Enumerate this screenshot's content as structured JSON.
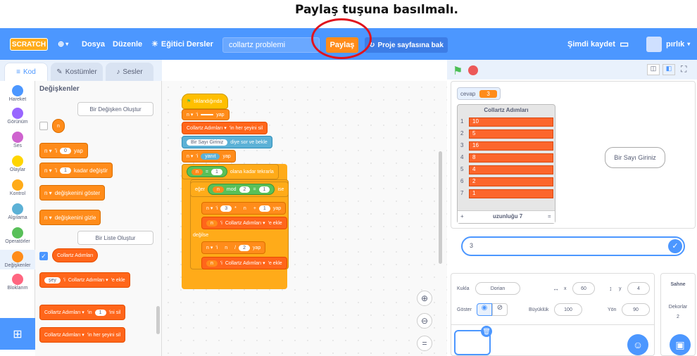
{
  "caption": "Paylaş tuşuna basılmalı.",
  "menubar": {
    "logo": "SCRATCH",
    "file": "Dosya",
    "edit": "Düzenle",
    "tutorials": "Eğitici Dersler",
    "project_title": "collartz problemi",
    "share": "Paylaş",
    "project_page": "Proje sayfasına bak",
    "save_now": "Şimdi kaydet",
    "username": "pırlık"
  },
  "tabs": {
    "code": "Kod",
    "costumes": "Kostümler",
    "sounds": "Sesler"
  },
  "categories": [
    "Hareket",
    "Görünüm",
    "Ses",
    "Olaylar",
    "Kontrol",
    "Algılama",
    "Operatörler",
    "Değişkenler",
    "Bloklarım"
  ],
  "palette": {
    "title": "Değişkenler",
    "make_var": "Bir Değişken Oluştur",
    "var_n": "n",
    "set_block": [
      "n ▾",
      "'i",
      "0",
      "yap"
    ],
    "change_block": [
      "n ▾",
      "'i",
      "1",
      "kadar değiştir"
    ],
    "show_var": [
      "n ▾",
      "değişkenini göster"
    ],
    "hide_var": [
      "n ▾",
      "değişkenini gizle"
    ],
    "make_list": "Bir Liste Oluştur",
    "list_name": "Collartz Adımları",
    "add_block": [
      "şey",
      "'i",
      "Collartz Adımları ▾",
      "'e ekle"
    ],
    "delete_block": [
      "Collartz Adımları ▾",
      "'in",
      "1",
      "'ini sil"
    ],
    "delete_all": [
      "Collartz Adımları ▾",
      "'in her şeyini sil"
    ]
  },
  "script": {
    "hat": "tıklandığında",
    "s1": [
      "n ▾",
      "'i",
      "",
      "yap"
    ],
    "s2": [
      "Collartz Adımları ▾",
      "'in her şeyini sil"
    ],
    "s3": [
      "Bir Sayı Giriniz",
      "diye sor ve bekle"
    ],
    "s4": [
      "n ▾",
      "'i",
      "yanıt",
      "yap"
    ],
    "repeat": [
      "n",
      "=",
      "1",
      "olana kadar tekrarla"
    ],
    "if": [
      "eğer",
      "n",
      "mod",
      "2",
      "=",
      "1",
      "ise"
    ],
    "s5": [
      "n ▾",
      "'i",
      "3",
      "*",
      "n",
      "+",
      "1",
      "yap"
    ],
    "s6": [
      "n",
      "'i",
      "Collartz Adımları ▾",
      "'e ekle"
    ],
    "else": "değilse",
    "s7": [
      "n ▾",
      "'i",
      "n",
      "/",
      "2",
      "yap"
    ],
    "s8": [
      "n",
      "'i",
      "Collartz Adımları ▾",
      "'e ekle"
    ]
  },
  "stage": {
    "var_label": "cevap",
    "var_value": "3",
    "list_title": "Collartz Adımları",
    "list_items": [
      "10",
      "5",
      "16",
      "8",
      "4",
      "2",
      "1"
    ],
    "list_footer_plus": "+",
    "list_length": "uzunluğu 7",
    "list_footer_eq": "=",
    "speech": "Bir Sayı Giriniz",
    "answer": "3"
  },
  "sprite": {
    "label_sprite": "Kukla",
    "name": "Dorian",
    "x_label": "x",
    "x": "60",
    "y_label": "y",
    "y": "4",
    "show_label": "Göster",
    "size_label": "Büyüklük",
    "size": "100",
    "dir_label": "Yön",
    "dir": "90"
  },
  "stage_pane": {
    "title": "Sahne",
    "backdrops_label": "Dekorlar",
    "backdrops": "2"
  }
}
